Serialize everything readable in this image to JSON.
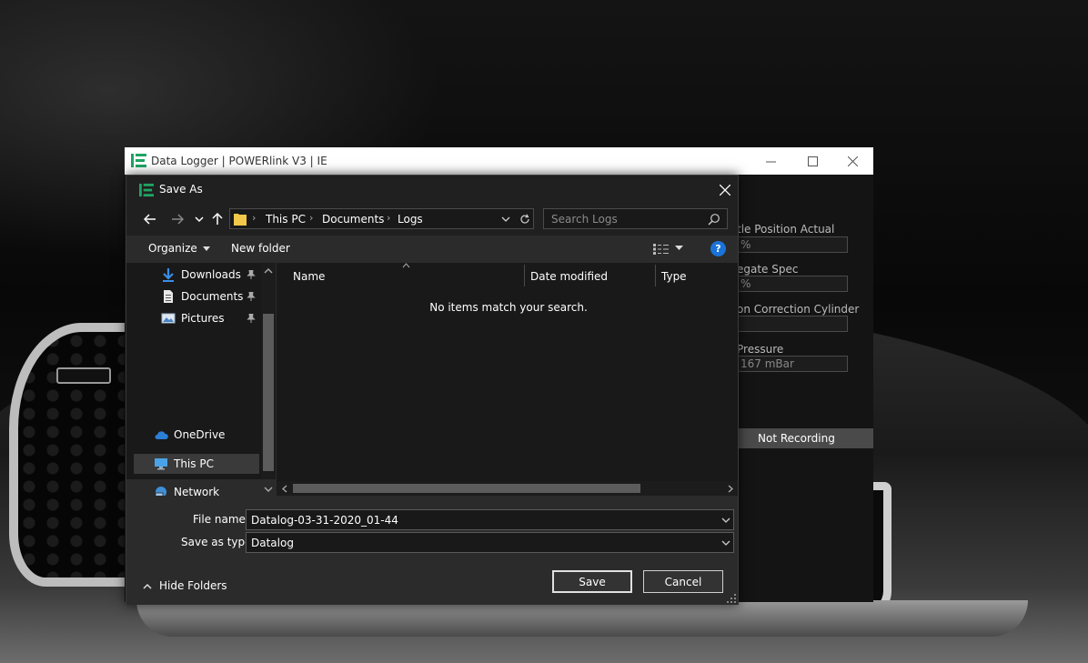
{
  "app": {
    "title": "Data Logger | POWERlink V3 | IE",
    "sensors": [
      {
        "label": "tle Position Actual",
        "value": "%"
      },
      {
        "label": "egate Spec",
        "value": "%"
      },
      {
        "label": "on Correction Cylinder",
        "value": ""
      },
      {
        "label": "Pressure",
        "value": "167 mBar"
      }
    ],
    "status": "Not Recording"
  },
  "dialog": {
    "title": "Save As",
    "address": {
      "crumbs": [
        "This PC",
        "Documents",
        "Logs"
      ]
    },
    "search": {
      "placeholder": "Search Logs"
    },
    "toolbar": {
      "organize": "Organize",
      "new_folder": "New folder",
      "help": "?"
    },
    "nav": {
      "quick_access": [
        {
          "label": "Downloads",
          "icon": "download-arrow-icon"
        },
        {
          "label": "Documents",
          "icon": "document-icon"
        },
        {
          "label": "Pictures",
          "icon": "picture-icon"
        }
      ],
      "onedrive": "OneDrive",
      "this_pc": "This PC",
      "network": "Network"
    },
    "columns": [
      "Name",
      "Date modified",
      "Type"
    ],
    "empty_message": "No items match your search.",
    "file_name_label": "File name:",
    "file_name_value": "Datalog-03-31-2020_01-44",
    "save_type_label": "Save as type:",
    "save_type_value": "Datalog",
    "hide_folders": "Hide Folders",
    "save_button": "Save",
    "cancel_button": "Cancel",
    "colors": {
      "accent": "#1a73d9",
      "logo_green": "#1fa463",
      "folder_yellow": "#f4c84a"
    }
  }
}
